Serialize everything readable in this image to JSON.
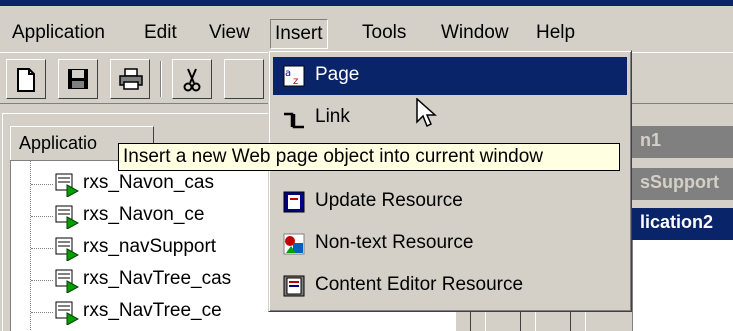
{
  "menubar": {
    "items": [
      {
        "label": "Application"
      },
      {
        "label": "Edit"
      },
      {
        "label": "View"
      },
      {
        "label": "Insert"
      },
      {
        "label": "Tools"
      },
      {
        "label": "Window"
      },
      {
        "label": "Help"
      }
    ],
    "open_menu": "Insert"
  },
  "toolbar": {
    "buttons": [
      {
        "icon": "new-document-icon"
      },
      {
        "icon": "save-icon"
      },
      {
        "icon": "print-icon"
      },
      {
        "icon": "cut-icon"
      }
    ]
  },
  "left_panel": {
    "tab_label": "Applicatio",
    "tree_items": [
      {
        "label": "rxs_Navon_cas",
        "icon": "resource-icon"
      },
      {
        "label": "rxs_Navon_ce",
        "icon": "resource-icon"
      },
      {
        "label": "rxs_navSupport",
        "icon": "resource-icon"
      },
      {
        "label": "rxs_NavTree_cas",
        "icon": "resource-icon"
      },
      {
        "label": "rxs_NavTree_ce",
        "icon": "resource-icon"
      }
    ]
  },
  "right_panes": {
    "header_1": "n1",
    "header_2": "sSupport",
    "header_3": "lication2"
  },
  "insert_menu": {
    "items": [
      {
        "label": "Page",
        "icon": "page-az-icon",
        "highlighted": true
      },
      {
        "label": "Link",
        "icon": "link-icon",
        "highlighted": false
      },
      {
        "label": "Update Resource",
        "icon": "update-resource-icon",
        "highlighted": false
      },
      {
        "label": "Non-text Resource",
        "icon": "non-text-resource-icon",
        "highlighted": false
      },
      {
        "label": "Content Editor Resource",
        "icon": "content-editor-resource-icon",
        "highlighted": false
      }
    ]
  },
  "tooltip": {
    "text": "Insert a new Web page object into current window"
  },
  "colors": {
    "face": "#d4d0c8",
    "highlight": "#0a246a",
    "tooltip_bg": "#ffffe1"
  }
}
